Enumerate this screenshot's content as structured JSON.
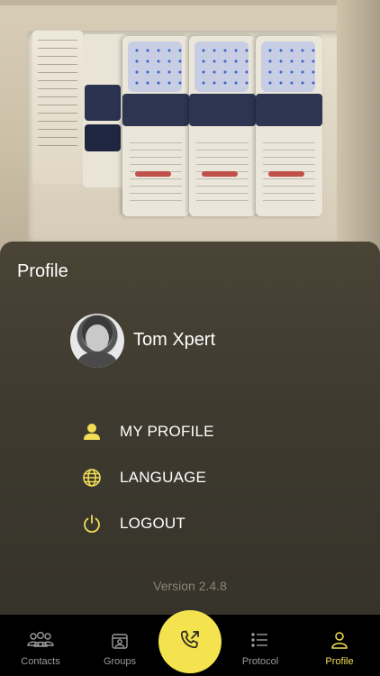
{
  "panel": {
    "title": "Profile"
  },
  "user": {
    "name": "Tom Xpert"
  },
  "menu": [
    {
      "label": "MY PROFILE",
      "icon": "person-icon"
    },
    {
      "label": "LANGUAGE",
      "icon": "globe-icon"
    },
    {
      "label": "LOGOUT",
      "icon": "power-icon"
    }
  ],
  "version": "Version 2.4.8",
  "tabs": [
    {
      "label": "Contacts",
      "icon": "contacts-icon"
    },
    {
      "label": "Groups",
      "icon": "groups-icon"
    },
    {
      "label": "Protocol",
      "icon": "list-icon"
    },
    {
      "label": "Profile",
      "icon": "profile-icon",
      "active": true
    }
  ],
  "call_button": {
    "icon": "phone-call-icon"
  },
  "colors": {
    "accent": "#f4e34f",
    "active_tab": "#f1de55",
    "inactive_tab": "#9a9a9a",
    "tabbar_bg": "#000000"
  }
}
